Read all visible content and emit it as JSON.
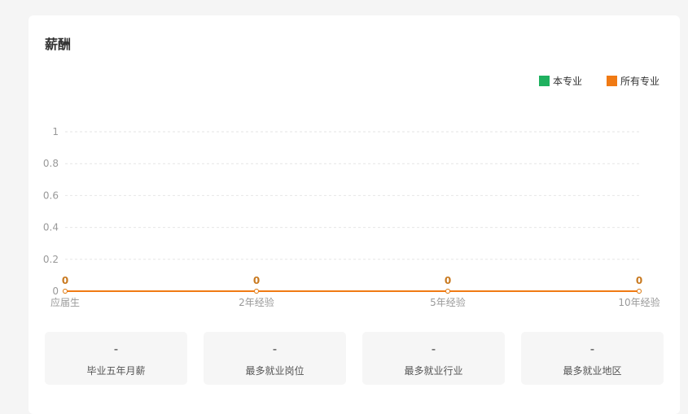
{
  "card": {
    "title": "薪酬"
  },
  "colors": {
    "series_major": "#1fb15f",
    "series_all": "#f07a14",
    "label_text": "#c8791f",
    "grid": "#e6e6e6",
    "axis_text": "#999999"
  },
  "chart_data": {
    "type": "line",
    "categories": [
      "应届生",
      "2年经验",
      "5年经验",
      "10年经验"
    ],
    "series": [
      {
        "name": "本专业",
        "color": "#1fb15f",
        "values": [
          0,
          0,
          0,
          0
        ]
      },
      {
        "name": "所有专业",
        "color": "#f07a14",
        "values": [
          0,
          0,
          0,
          0
        ]
      }
    ],
    "data_labels": [
      "0",
      "0",
      "0",
      "0"
    ],
    "ylim": [
      0,
      1
    ],
    "yticks": [
      0,
      0.2,
      0.4,
      0.6,
      0.8,
      1
    ],
    "ytick_labels": [
      "0",
      "0.2",
      "0.4",
      "0.6",
      "0.8",
      "1"
    ],
    "grid": true,
    "legend": "top-right"
  },
  "stats": [
    {
      "value": "-",
      "label": "毕业五年月薪"
    },
    {
      "value": "-",
      "label": "最多就业岗位"
    },
    {
      "value": "-",
      "label": "最多就业行业"
    },
    {
      "value": "-",
      "label": "最多就业地区"
    }
  ]
}
